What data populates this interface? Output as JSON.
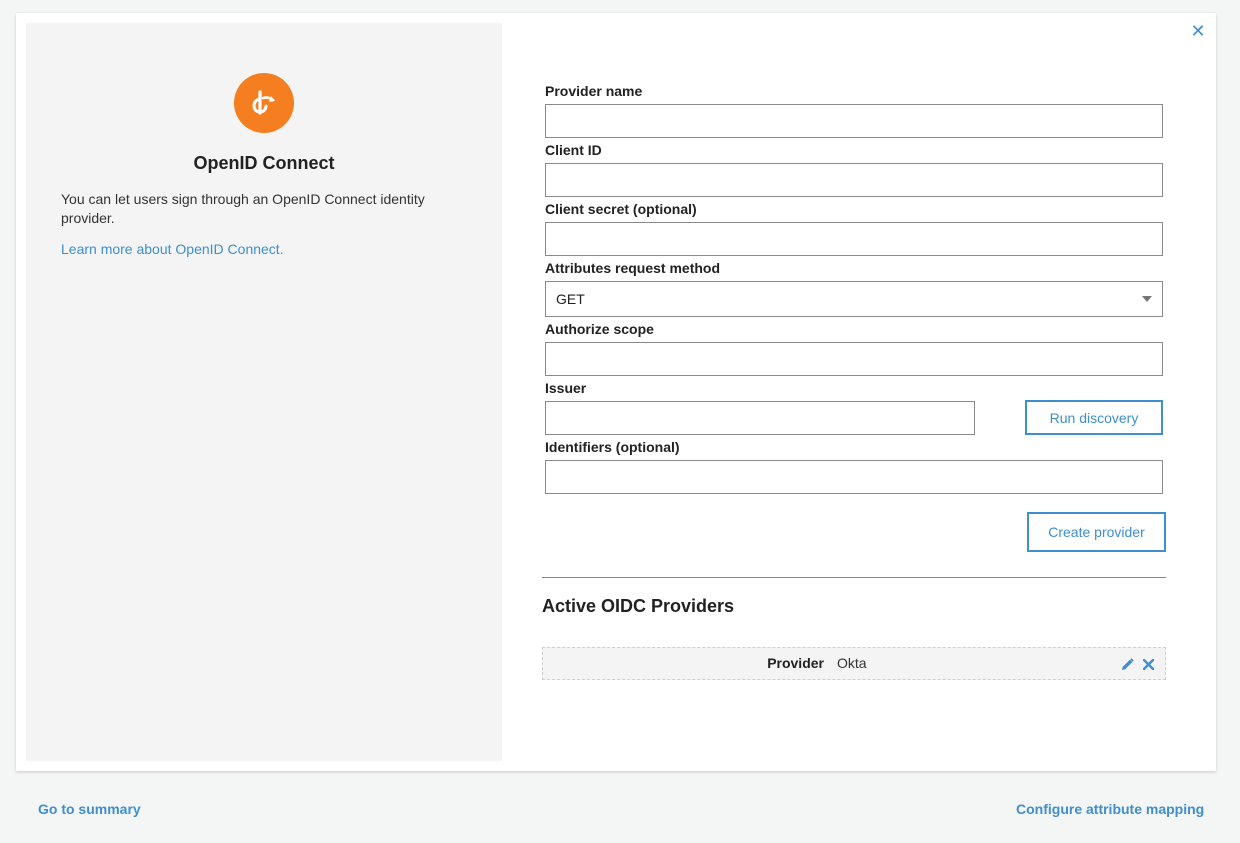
{
  "intro": {
    "title": "OpenID Connect",
    "description": "You can let users sign through an OpenID Connect identity provider.",
    "learn_more": "Learn more about OpenID Connect."
  },
  "form": {
    "provider_name_label": "Provider name",
    "provider_name_value": "",
    "client_id_label": "Client ID",
    "client_id_value": "",
    "client_secret_label": "Client secret (optional)",
    "client_secret_value": "",
    "attributes_method_label": "Attributes request method",
    "attributes_method_value": "GET",
    "authorize_scope_label": "Authorize scope",
    "authorize_scope_value": "",
    "issuer_label": "Issuer",
    "issuer_value": "",
    "run_discovery": "Run discovery",
    "identifiers_label": "Identifiers (optional)",
    "identifiers_value": "",
    "create_provider": "Create provider"
  },
  "active_providers": {
    "title": "Active OIDC Providers",
    "rows": [
      {
        "key": "Provider",
        "value": "Okta"
      }
    ]
  },
  "footer": {
    "summary_link": "Go to summary",
    "mapping_link": "Configure attribute mapping"
  },
  "colors": {
    "accent": "#3f8ed0",
    "brand_orange": "#f47e20"
  },
  "icons": {
    "close": "close-icon",
    "logo": "openid-logo-icon",
    "edit": "pencil-icon",
    "delete": "delete-icon"
  }
}
